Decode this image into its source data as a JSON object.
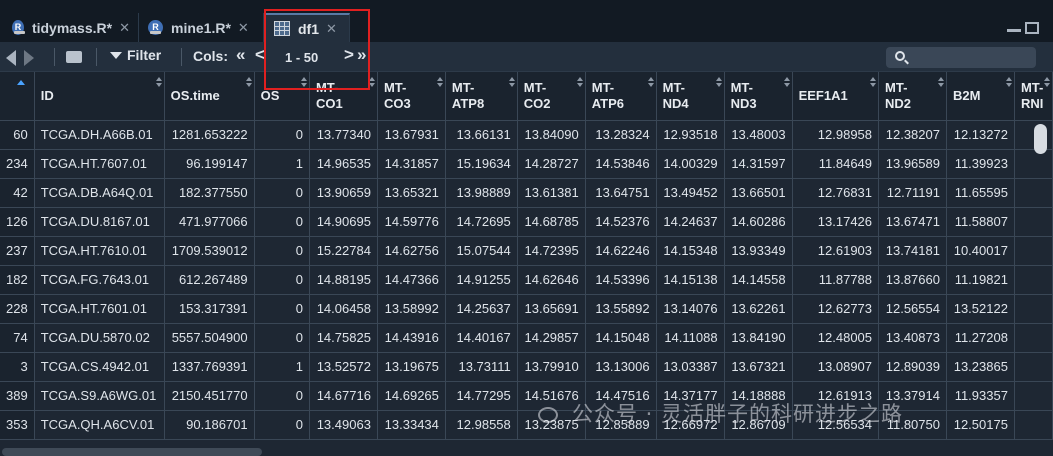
{
  "tabs": [
    {
      "label": "tidymass.R*",
      "icon": "r-script-icon"
    },
    {
      "label": "mine1.R*",
      "icon": "r-script-icon"
    },
    {
      "label": "df1",
      "icon": "data-grid-icon"
    }
  ],
  "toolbar": {
    "filter_label": "Filter",
    "cols_label": "Cols:",
    "cols_range": "1 - 50",
    "prev_cols": "«",
    "prev_col": "<",
    "next_col": ">",
    "next_cols": "»"
  },
  "table": {
    "columns": [
      {
        "label": "",
        "sortable": false
      },
      {
        "label": "ID"
      },
      {
        "label": "OS.time"
      },
      {
        "label": "OS"
      },
      {
        "label": "MT-\nCO1"
      },
      {
        "label": "MT-\nCO3"
      },
      {
        "label": "MT-\nATP8"
      },
      {
        "label": "MT-\nCO2"
      },
      {
        "label": "MT-\nATP6"
      },
      {
        "label": "MT-\nND4"
      },
      {
        "label": "MT-\nND3"
      },
      {
        "label": "EEF1A1"
      },
      {
        "label": "MT-\nND2"
      },
      {
        "label": "B2M"
      },
      {
        "label": "MT-\nRNI"
      }
    ],
    "rows": [
      [
        "60",
        "TCGA.DH.A66B.01",
        "1281.653222",
        "0",
        "13.77340",
        "13.67931",
        "13.66131",
        "13.84090",
        "13.28324",
        "12.93518",
        "13.48003",
        "12.98958",
        "12.38207",
        "12.13272",
        ""
      ],
      [
        "234",
        "TCGA.HT.7607.01",
        "96.199147",
        "1",
        "14.96535",
        "14.31857",
        "15.19634",
        "14.28727",
        "14.53846",
        "14.00329",
        "14.31597",
        "11.84649",
        "13.96589",
        "11.39923",
        ""
      ],
      [
        "42",
        "TCGA.DB.A64Q.01",
        "182.377550",
        "0",
        "13.90659",
        "13.65321",
        "13.98889",
        "13.61381",
        "13.64751",
        "13.49452",
        "13.66501",
        "12.76831",
        "12.71191",
        "11.65595",
        ""
      ],
      [
        "126",
        "TCGA.DU.8167.01",
        "471.977066",
        "0",
        "14.90695",
        "14.59776",
        "14.72695",
        "14.68785",
        "14.52376",
        "14.24637",
        "14.60286",
        "13.17426",
        "13.67471",
        "11.58807",
        ""
      ],
      [
        "237",
        "TCGA.HT.7610.01",
        "1709.539012",
        "0",
        "15.22784",
        "14.62756",
        "15.07544",
        "14.72395",
        "14.62246",
        "14.15348",
        "13.93349",
        "12.61903",
        "13.74181",
        "10.40017",
        ""
      ],
      [
        "182",
        "TCGA.FG.7643.01",
        "612.267489",
        "0",
        "14.88195",
        "14.47366",
        "14.91255",
        "14.62646",
        "14.53396",
        "14.15138",
        "14.14558",
        "11.87788",
        "13.87660",
        "11.19821",
        ""
      ],
      [
        "228",
        "TCGA.HT.7601.01",
        "153.317391",
        "0",
        "14.06458",
        "13.58992",
        "14.25637",
        "13.65691",
        "13.55892",
        "13.14076",
        "13.62261",
        "12.62773",
        "12.56554",
        "13.52122",
        ""
      ],
      [
        "74",
        "TCGA.DU.5870.02",
        "5557.504900",
        "0",
        "14.75825",
        "14.43916",
        "14.40167",
        "14.29857",
        "14.15048",
        "14.11088",
        "13.84190",
        "12.48005",
        "13.40873",
        "11.27208",
        ""
      ],
      [
        "3",
        "TCGA.CS.4942.01",
        "1337.769391",
        "1",
        "13.52572",
        "13.19675",
        "13.73111",
        "13.79910",
        "13.13006",
        "13.03387",
        "13.67321",
        "13.08907",
        "12.89039",
        "13.23865",
        ""
      ],
      [
        "389",
        "TCGA.S9.A6WG.01",
        "2150.451770",
        "0",
        "14.67716",
        "14.69265",
        "14.77295",
        "14.51676",
        "14.47516",
        "14.37177",
        "14.18888",
        "12.61913",
        "13.37914",
        "11.93357",
        ""
      ],
      [
        "353",
        "TCGA.QH.A6CV.01",
        "90.186701",
        "0",
        "13.49063",
        "13.33434",
        "12.98558",
        "13.23875",
        "12.85889",
        "12.66972",
        "12.86709",
        "12.56534",
        "11.80750",
        "12.50175",
        ""
      ]
    ]
  },
  "watermark": "公众号 · 灵活胖子的科研进步之路",
  "colors": {
    "highlight": "#e02020",
    "background": "#1e2733",
    "header": "#1a232e"
  }
}
